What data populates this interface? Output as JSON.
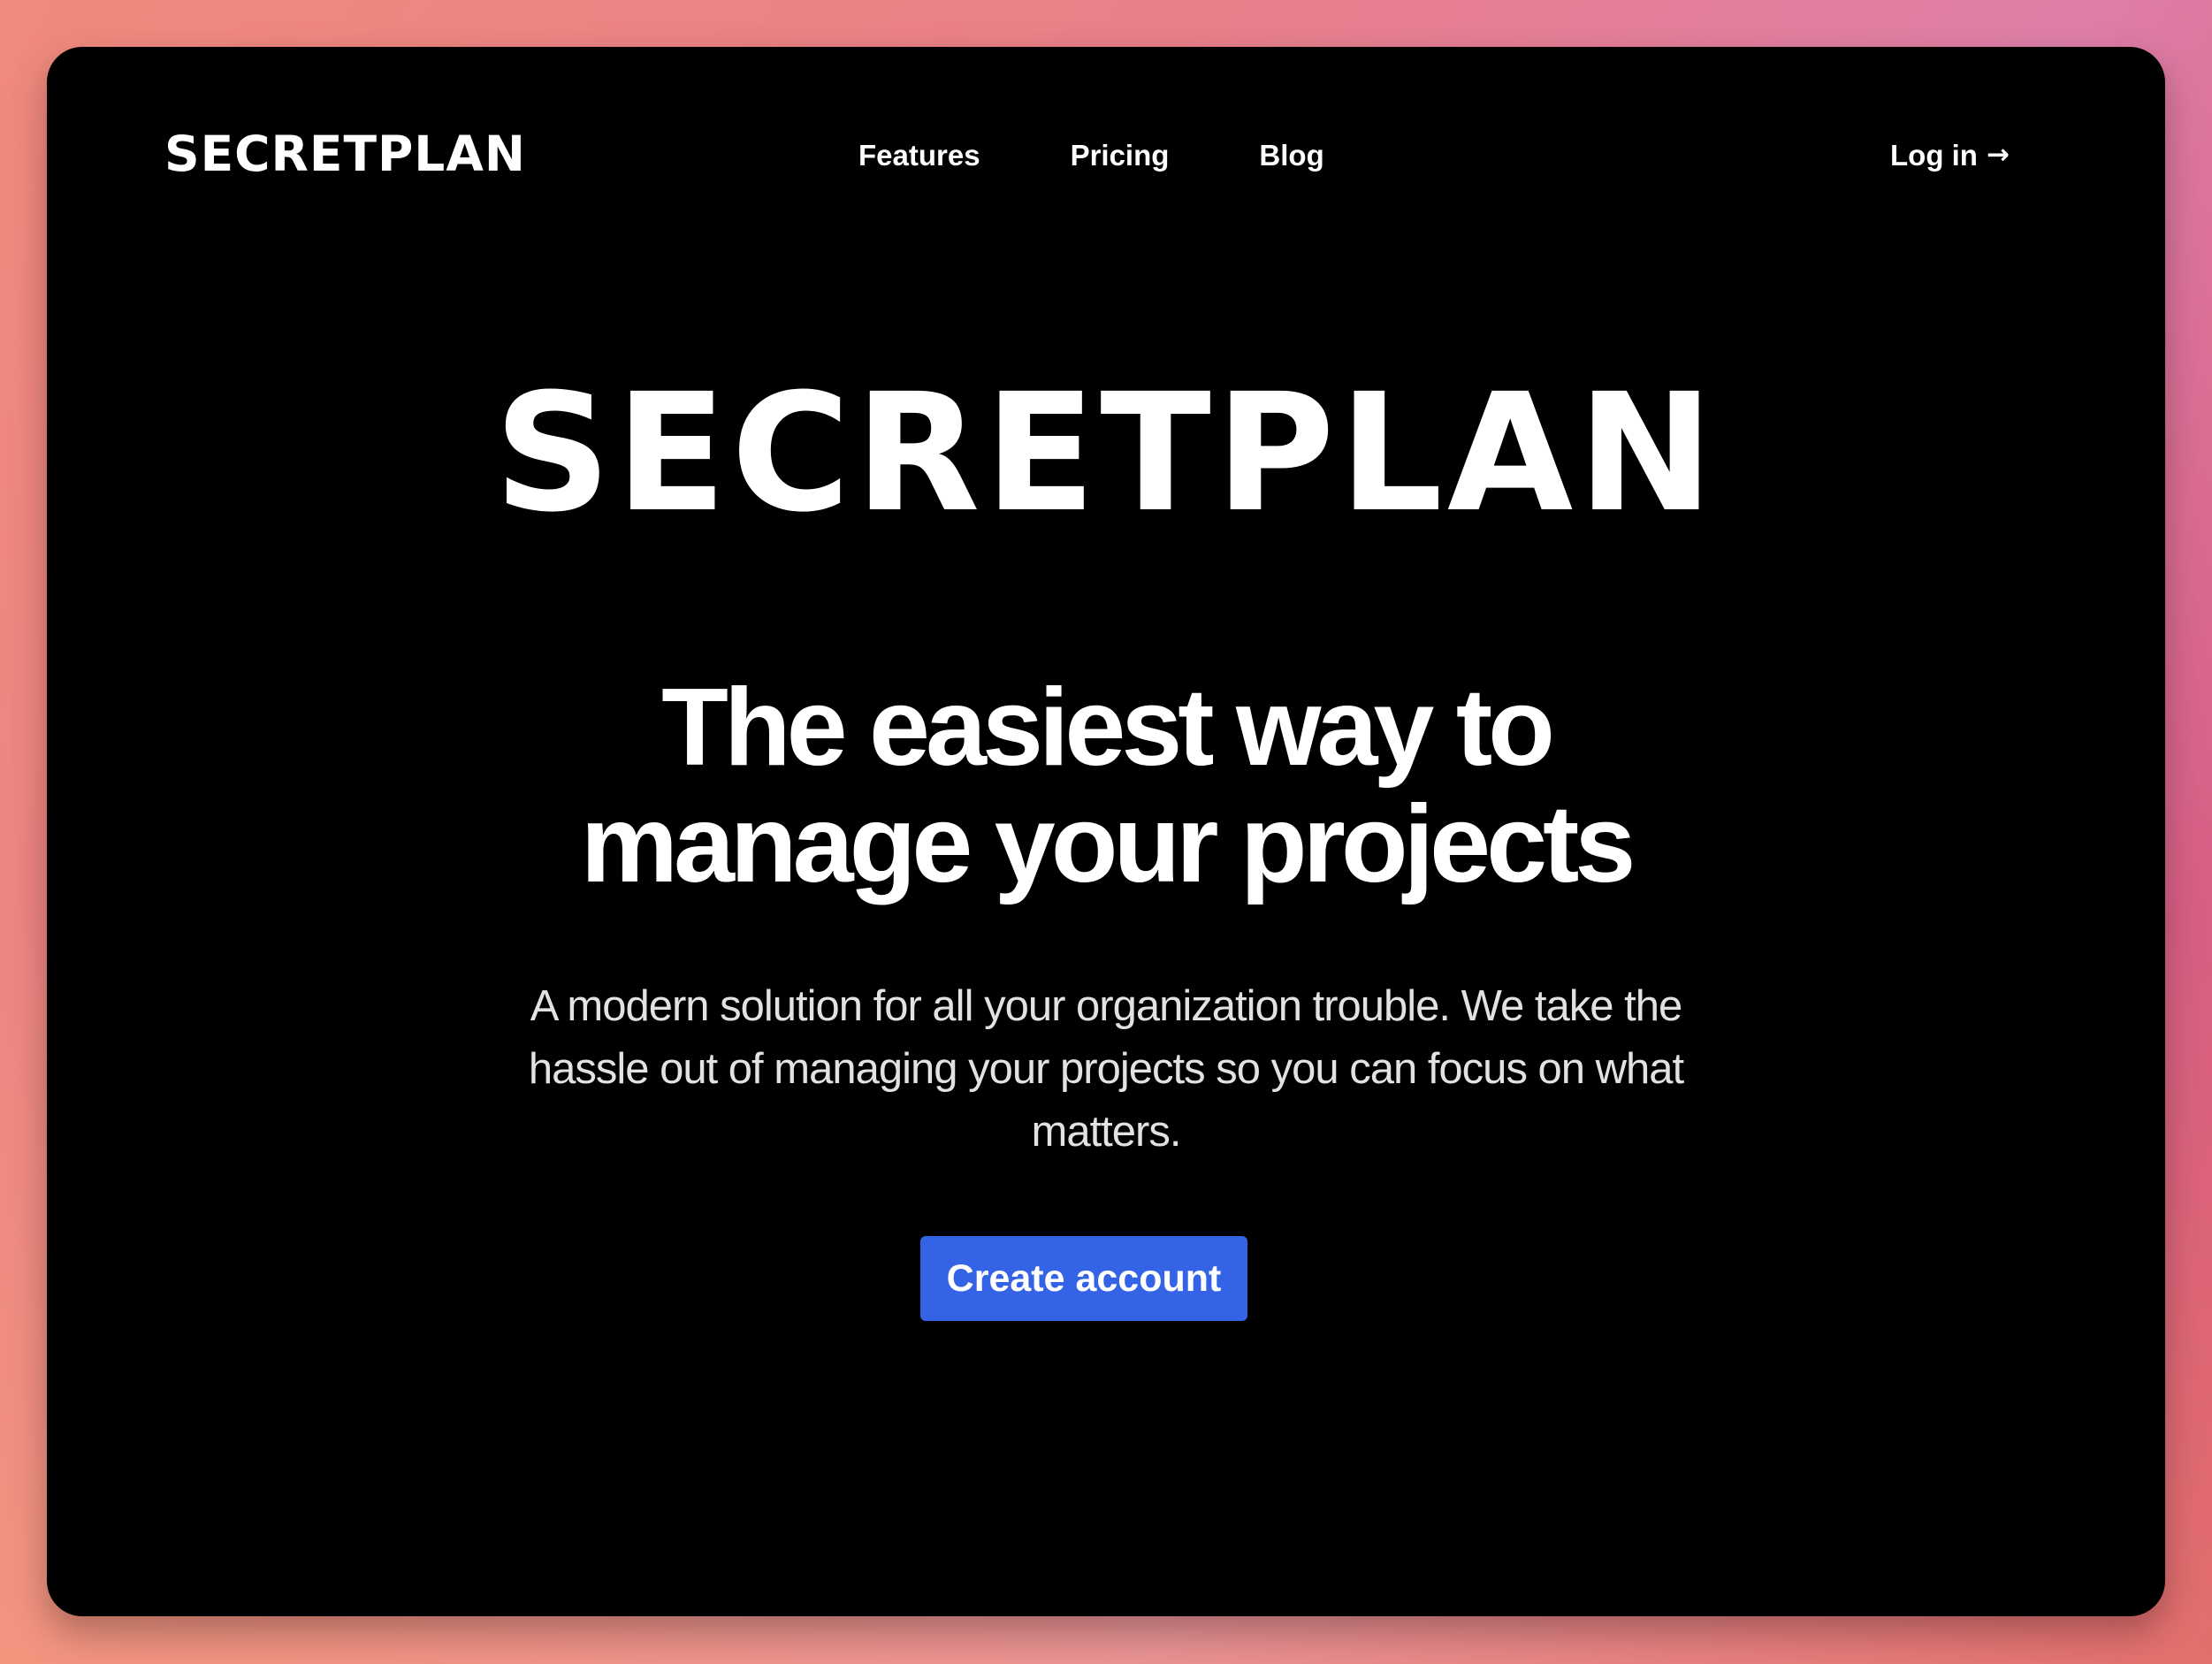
{
  "brand": {
    "logo_text": "SECRETPLAN"
  },
  "nav": {
    "items": [
      {
        "label": "Features"
      },
      {
        "label": "Pricing"
      },
      {
        "label": "Blog"
      }
    ],
    "login_label": "Log in",
    "login_icon": "arrow-right-icon"
  },
  "hero": {
    "logo_text": "SECRETPLAN",
    "headline_line1": "The easiest way to",
    "headline_line2": "manage your projects",
    "subtext": "A modern solution for all your organization trouble. We take the hassle out of managing your projects so you can focus on what matters.",
    "cta_label": "Create account"
  },
  "colors": {
    "window_background": "#000000",
    "cta_background": "#3563e5",
    "text_primary": "#ffffff",
    "text_secondary": "#e2e2e2"
  }
}
